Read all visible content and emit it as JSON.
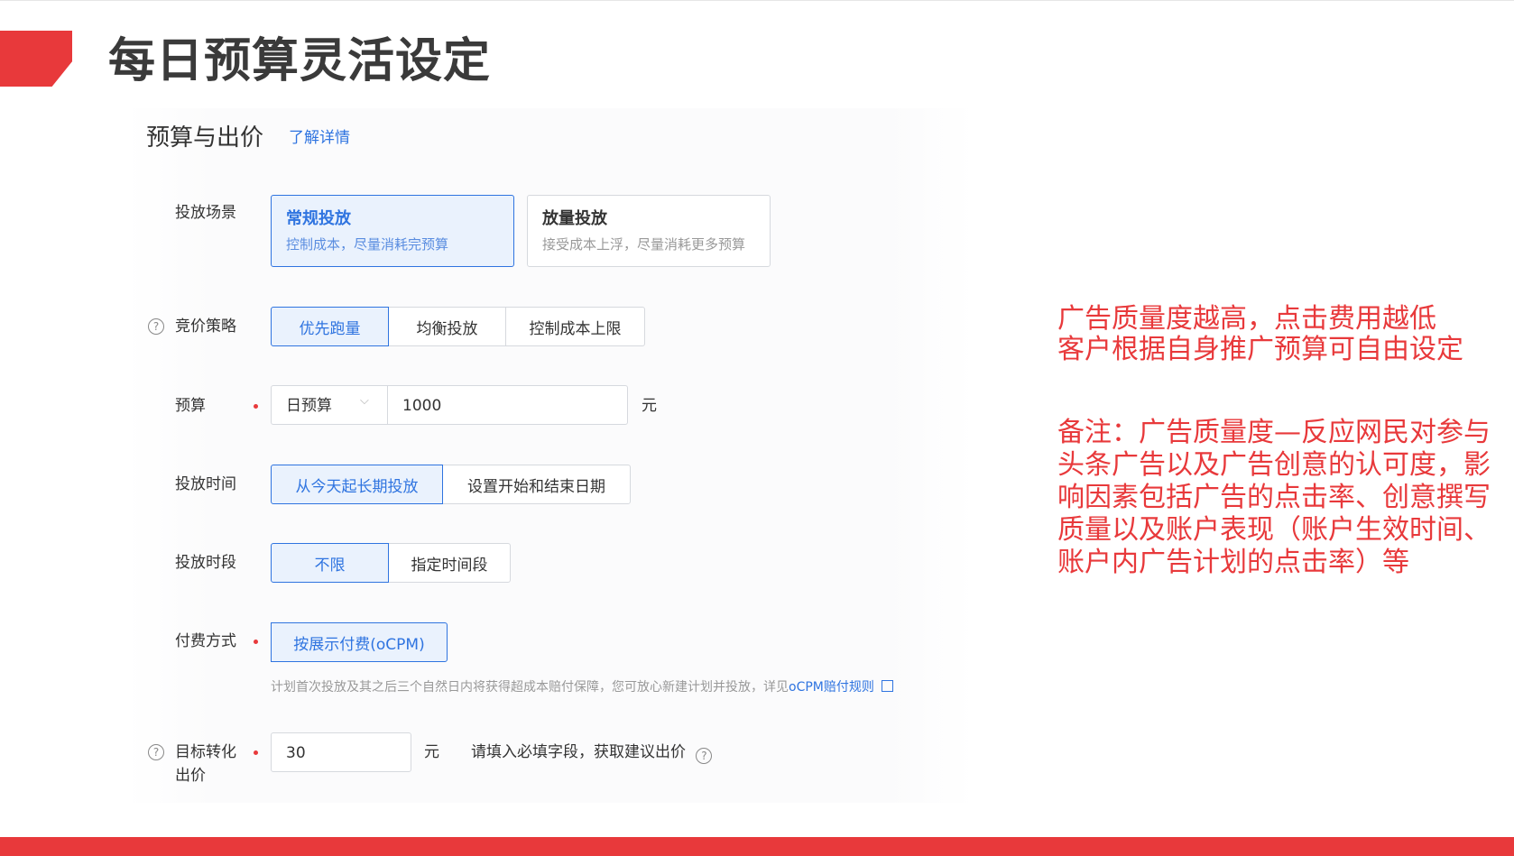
{
  "slide": {
    "title": "每日预算灵活设定"
  },
  "section": {
    "title": "预算与出价",
    "learn_more": "了解详情"
  },
  "scene": {
    "label": "投放场景",
    "options": [
      {
        "title": "常规投放",
        "desc": "控制成本，尽量消耗完预算",
        "selected": true
      },
      {
        "title": "放量投放",
        "desc": "接受成本上浮，尽量消耗更多预算",
        "selected": false
      }
    ]
  },
  "bid_strategy": {
    "label": "竞价策略",
    "options": [
      "优先跑量",
      "均衡投放",
      "控制成本上限"
    ],
    "selected": "优先跑量"
  },
  "budget": {
    "label": "预算",
    "type": "日预算",
    "value": "1000",
    "unit": "元"
  },
  "schedule": {
    "label": "投放时间",
    "options": [
      "从今天起长期投放",
      "设置开始和结束日期"
    ],
    "selected": "从今天起长期投放"
  },
  "time_slot": {
    "label": "投放时段",
    "options": [
      "不限",
      "指定时间段"
    ],
    "selected": "不限"
  },
  "payment": {
    "label": "付费方式",
    "option": "按展示付费(oCPM)",
    "notice": "计划首次投放及其之后三个自然日内将获得超成本赔付保障，您可放心新建计划并投放，详见",
    "notice_link": "oCPM赔付规则"
  },
  "target_bid": {
    "label_line1": "目标转化",
    "label_line2": "出价",
    "value": "30",
    "unit": "元",
    "hint": "请填入必填字段，获取建议出价"
  },
  "notes": {
    "line1": "广告质量度越高，点击费用越低",
    "line2": "客户根据自身推广预算可自由设定",
    "remark": [
      "备注：广告质量度—反应网民对参与",
      "头条广告以及广告创意的认可度，影",
      "响因素包括广告的点击率、创意撰写",
      "质量以及账户表现（账户生效时间、",
      "账户内广告计划的点击率）等"
    ]
  },
  "colors": {
    "accent": "#e8393b",
    "primary_blue": "#2f74e0",
    "selected_bg": "#eaf2fd"
  }
}
